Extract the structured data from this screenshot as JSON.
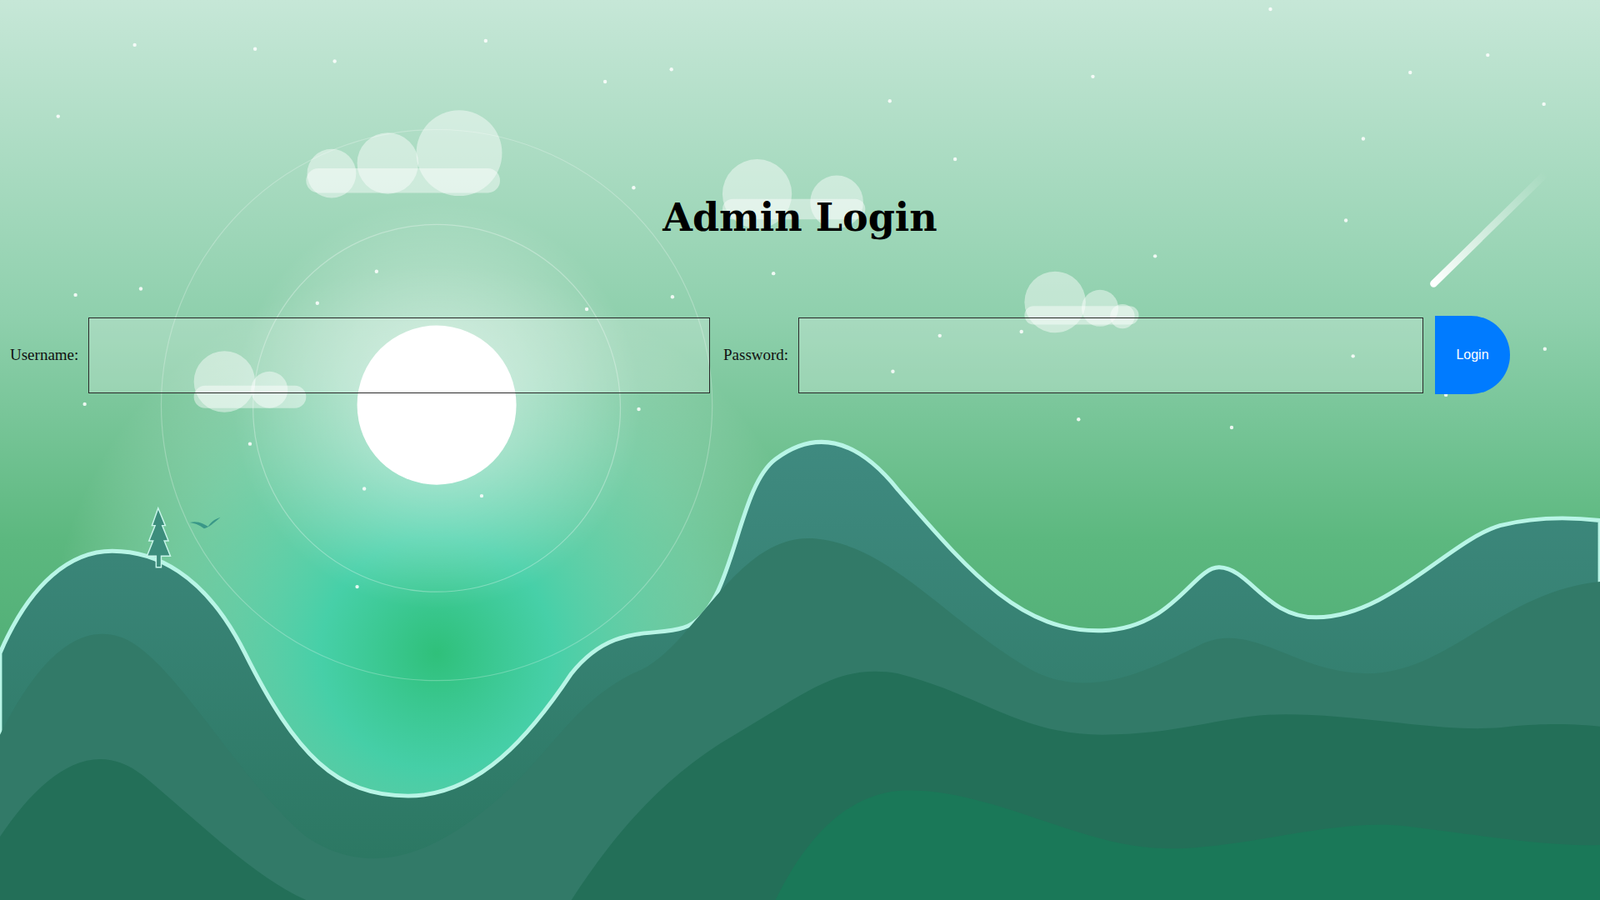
{
  "page": {
    "title": "Admin Login"
  },
  "form": {
    "fields": [
      {
        "label": "Username:",
        "kind": "text",
        "value": ""
      },
      {
        "label": "Password:",
        "kind": "password",
        "value": ""
      }
    ],
    "button": "Login"
  }
}
